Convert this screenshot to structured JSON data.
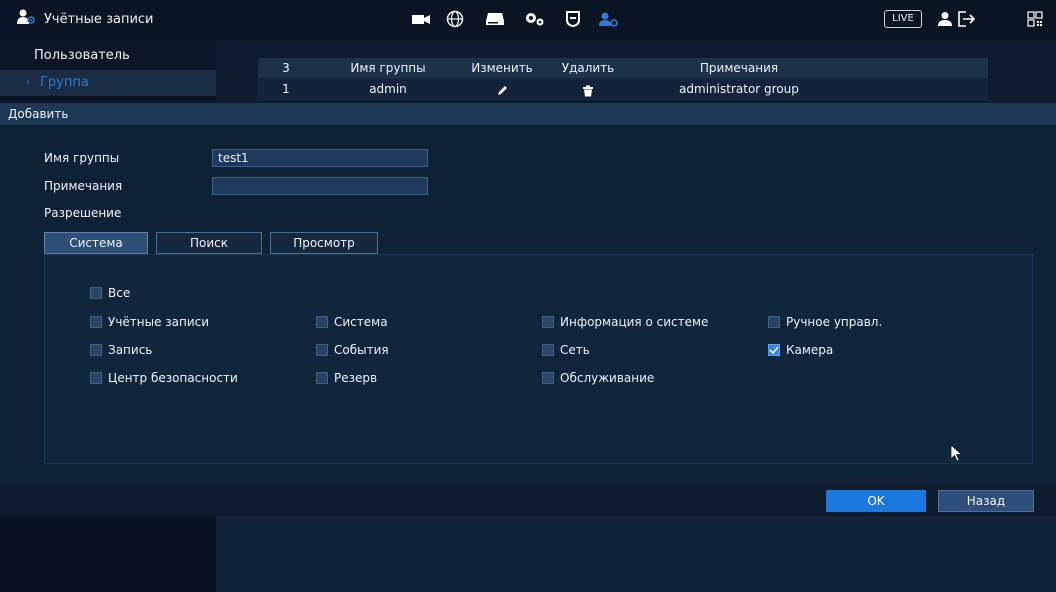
{
  "header": {
    "title": "Учётные записи",
    "live_label": "LIVE",
    "icons": [
      "users-icon",
      "camera-icon",
      "network-icon",
      "storage-icon",
      "settings-icon",
      "security-icon",
      "accounts-icon",
      "user-icon",
      "logout-icon",
      "qr-icon"
    ]
  },
  "sidebar": {
    "items": [
      {
        "label": "Пользователь"
      },
      {
        "label": "Группа"
      }
    ]
  },
  "group_table": {
    "headers": [
      "3",
      "Имя группы",
      "Изменить",
      "Удалить",
      "Примечания"
    ],
    "rows": [
      {
        "index": "1",
        "name": "admin",
        "note": "administrator group"
      }
    ]
  },
  "add_section": {
    "title": "Добавить",
    "group_name_label": "Имя группы",
    "group_name_value": "test1",
    "notes_label": "Примечания",
    "notes_value": "",
    "permission_label": "Разрешение"
  },
  "tabs": [
    "Система",
    "Поиск",
    "Просмотр"
  ],
  "permissions": {
    "all": {
      "label": "Все",
      "checked": false
    },
    "items": [
      {
        "label": "Учётные записи",
        "checked": false
      },
      {
        "label": "Система",
        "checked": false
      },
      {
        "label": "Информация о системе",
        "checked": false
      },
      {
        "label": "Ручное управл.",
        "checked": false
      },
      {
        "label": "Запись",
        "checked": false
      },
      {
        "label": "События",
        "checked": false
      },
      {
        "label": "Сеть",
        "checked": false
      },
      {
        "label": "Камера",
        "checked": true
      },
      {
        "label": "Центр безопасности",
        "checked": false
      },
      {
        "label": "Резерв",
        "checked": false
      },
      {
        "label": "Обслуживание",
        "checked": false
      }
    ]
  },
  "buttons": {
    "ok": "OK",
    "back": "Назад"
  },
  "colors": {
    "accent": "#1a78e0",
    "active_text": "#2a7cd6",
    "background": "#0f2135"
  }
}
